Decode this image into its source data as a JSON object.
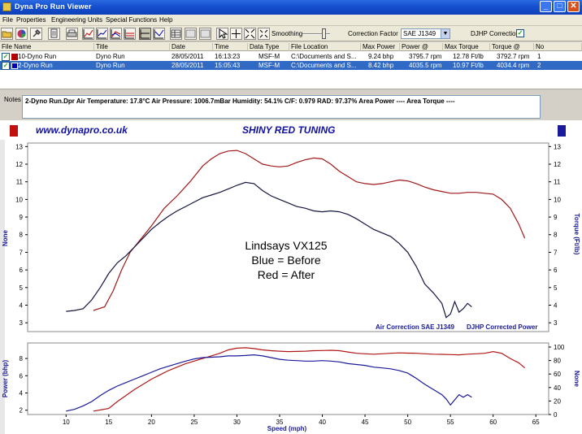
{
  "window": {
    "title": "Dyna Pro Run Viewer",
    "minimize": "_",
    "maximize": "□",
    "close": "✕"
  },
  "menu": [
    "File",
    "Properties",
    "Engineering Units",
    "Special Functions",
    "Help"
  ],
  "toolbar": {
    "smoothing_label": "Smoothing",
    "correction_factor_label": "Correction Factor",
    "correction_factor_value": "SAE J1349",
    "djhp_label": "DJHP Correction",
    "djhp_checked": "✓"
  },
  "runs_table": {
    "headers": [
      "File Name",
      "Title",
      "Date",
      "Time",
      "Data Type",
      "File Location",
      "Max Power",
      "Power @",
      "Max Torque",
      "Torque @",
      "No"
    ],
    "rows": [
      {
        "file": "10-Dyno Run",
        "title": "Dyno Run",
        "date": "28/05/2011",
        "time": "16:13:23",
        "type": "MSF-M",
        "location": "C:\\Documents and S...",
        "max_power": "9.24 bhp",
        "power_at": "3795.7 rpm",
        "max_torque": "12.78 Ft/lb",
        "torque_at": "3792.7 rpm",
        "no": "1",
        "color": "#b00000",
        "selected": false
      },
      {
        "file": "2-Dyno Run",
        "title": "Dyno Run",
        "date": "28/05/2011",
        "time": "15:05:43",
        "type": "MSF-M",
        "location": "C:\\Documents and S...",
        "max_power": "8.42 bhp",
        "power_at": "4035.5 rpm",
        "max_torque": "10.97 Ft/lb",
        "torque_at": "4034.4 rpm",
        "no": "2",
        "color": "#0000b0",
        "selected": true
      }
    ]
  },
  "notes": {
    "label": "Notes",
    "text": "2-Dyno Run.Dpr   Air Temperature: 17.8°C   Air Pressure: 1006.7mBar   Humidity: 54.1%   C/F: 0.979   RAD: 97.37%  Area Power ----   Area Torque ----"
  },
  "chart_header": {
    "site": "www.dynapro.co.uk",
    "brand": "SHINY RED TUNING"
  },
  "chart_data": [
    {
      "type": "line",
      "title": "",
      "xlabel": "",
      "ylabel_left": "None",
      "ylabel_right": "Torque (Ft/lb)",
      "xlim": [
        5.5,
        66.5
      ],
      "ylim": [
        2.5,
        13.2
      ],
      "yticks": [
        3,
        4,
        5,
        6,
        7,
        8,
        9,
        10,
        11,
        12,
        13
      ],
      "annotation_lines": [
        "Lindsays VX125",
        "Blue = Before",
        "Red = After"
      ],
      "footer_left": "Air Correction SAE J1349",
      "footer_right": "DJHP Corrected Power",
      "grid": false,
      "series": [
        {
          "name": "After",
          "color": "#a01818",
          "x": [
            13.2,
            14.5,
            15.5,
            16.5,
            17.5,
            18.5,
            20,
            21.5,
            23,
            24.5,
            26,
            27,
            28,
            29,
            30,
            31,
            32,
            33,
            34,
            35,
            36,
            37,
            38,
            39,
            40,
            41,
            42,
            43,
            44,
            45,
            46,
            47,
            48,
            49,
            50,
            51,
            52,
            53,
            54,
            55,
            56,
            57,
            58,
            59,
            60,
            61,
            62,
            63,
            63.7
          ],
          "y": [
            3.7,
            3.9,
            4.8,
            6.0,
            7.0,
            7.6,
            8.5,
            9.5,
            10.2,
            11.0,
            11.9,
            12.3,
            12.6,
            12.75,
            12.78,
            12.6,
            12.3,
            12.0,
            11.9,
            11.85,
            11.9,
            12.1,
            12.25,
            12.35,
            12.3,
            12.0,
            11.6,
            11.3,
            11.0,
            10.9,
            10.85,
            10.9,
            11.0,
            11.1,
            11.05,
            10.9,
            10.7,
            10.55,
            10.45,
            10.35,
            10.35,
            10.4,
            10.4,
            10.35,
            10.3,
            10.0,
            9.5,
            8.6,
            7.8
          ]
        },
        {
          "name": "Before",
          "color": "#151540",
          "x": [
            10,
            11,
            12,
            13,
            14,
            15,
            16,
            17,
            18,
            19,
            20,
            21,
            22,
            23,
            24,
            25,
            26,
            27,
            28,
            29,
            30,
            31,
            32,
            33,
            34,
            35,
            36,
            37,
            38,
            39,
            40,
            41,
            42,
            43,
            44,
            45,
            46,
            47,
            48,
            49,
            50,
            51,
            52,
            53,
            54,
            54.5,
            55,
            55.5,
            56,
            56.5,
            57,
            57.5
          ],
          "y": [
            3.65,
            3.7,
            3.8,
            4.3,
            5.0,
            5.8,
            6.4,
            6.8,
            7.3,
            7.8,
            8.3,
            8.7,
            9.05,
            9.35,
            9.6,
            9.85,
            10.1,
            10.25,
            10.4,
            10.6,
            10.8,
            10.97,
            10.9,
            10.5,
            10.2,
            10.0,
            9.8,
            9.6,
            9.5,
            9.35,
            9.3,
            9.35,
            9.3,
            9.15,
            8.9,
            8.6,
            8.3,
            8.1,
            7.9,
            7.5,
            7.0,
            6.2,
            5.2,
            4.7,
            4.1,
            3.3,
            3.5,
            4.2,
            3.6,
            3.8,
            4.1,
            3.9
          ]
        }
      ]
    },
    {
      "type": "line",
      "xlabel": "Speed (mph)",
      "ylabel_left": "Power (bhp)",
      "ylabel_right": "None",
      "xlim": [
        5.5,
        66.5
      ],
      "ylim": [
        1.5,
        9.8
      ],
      "yticks": [
        2,
        4,
        6,
        8
      ],
      "yticks_right": [
        0,
        20,
        40,
        60,
        80,
        100
      ],
      "xticks": [
        10,
        15,
        20,
        25,
        30,
        35,
        40,
        45,
        50,
        55,
        60,
        65
      ],
      "grid": false,
      "series": [
        {
          "name": "After",
          "color": "#b01818",
          "x": [
            13.2,
            15,
            16,
            17,
            18,
            19,
            20,
            21,
            22,
            23,
            24,
            25,
            26,
            27,
            28,
            29,
            30,
            31,
            32,
            33,
            34,
            35,
            36,
            37,
            38,
            39,
            40,
            41,
            42,
            43,
            44,
            45,
            46,
            47,
            48,
            49,
            50,
            51,
            52,
            53,
            54,
            55,
            56,
            57,
            58,
            59,
            60,
            61,
            62,
            63,
            63.7
          ],
          "y": [
            1.9,
            2.2,
            3.0,
            3.7,
            4.4,
            5.0,
            5.6,
            6.1,
            6.6,
            7.0,
            7.4,
            7.7,
            8.0,
            8.3,
            8.6,
            9.0,
            9.2,
            9.24,
            9.15,
            9.0,
            8.9,
            8.85,
            8.8,
            8.82,
            8.85,
            8.9,
            8.92,
            8.95,
            8.9,
            8.75,
            8.6,
            8.55,
            8.5,
            8.55,
            8.6,
            8.65,
            8.62,
            8.6,
            8.55,
            8.5,
            8.48,
            8.45,
            8.42,
            8.5,
            8.55,
            8.6,
            8.8,
            8.6,
            8.0,
            7.5,
            6.9
          ]
        },
        {
          "name": "Before",
          "color": "#1a1a9a",
          "x": [
            10,
            11,
            12,
            13,
            14,
            15,
            16,
            17,
            18,
            19,
            20,
            21,
            22,
            23,
            24,
            25,
            26,
            27,
            28,
            29,
            30,
            31,
            32,
            33,
            34,
            35,
            36,
            37,
            38,
            39,
            40,
            41,
            42,
            43,
            44,
            45,
            46,
            47,
            48,
            49,
            50,
            51,
            52,
            53,
            54,
            54.5,
            55,
            55.5,
            56,
            56.5,
            57,
            57.5
          ],
          "y": [
            1.9,
            2.1,
            2.5,
            3.0,
            3.7,
            4.3,
            4.8,
            5.2,
            5.6,
            6.0,
            6.4,
            6.8,
            7.1,
            7.4,
            7.7,
            7.95,
            8.1,
            8.15,
            8.2,
            8.3,
            8.3,
            8.35,
            8.42,
            8.3,
            8.1,
            7.9,
            7.8,
            7.75,
            7.7,
            7.7,
            7.75,
            7.7,
            7.6,
            7.4,
            7.3,
            7.2,
            7.0,
            6.9,
            6.8,
            6.6,
            6.3,
            5.7,
            5.0,
            4.4,
            3.8,
            3.3,
            2.6,
            3.2,
            3.8,
            3.5,
            3.8,
            3.5
          ]
        }
      ]
    }
  ]
}
